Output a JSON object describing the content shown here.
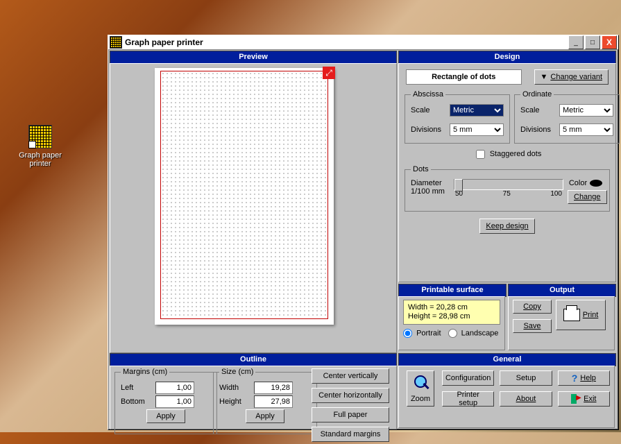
{
  "desktop": {
    "icon_label": "Graph paper printer"
  },
  "window": {
    "title": "Graph paper printer",
    "min": "_",
    "max": "□",
    "close": "X"
  },
  "preview": {
    "title": "Preview"
  },
  "outline": {
    "title": "Outline",
    "margins_legend": "Margins (cm)",
    "left_label": "Left",
    "left_value": "1,00",
    "bottom_label": "Bottom",
    "bottom_value": "1,00",
    "apply": "Apply",
    "size_legend": "Size (cm)",
    "width_label": "Width",
    "width_value": "19,28",
    "height_label": "Height",
    "height_value": "27,98",
    "btn_center_v": "Center vertically",
    "btn_center_h": "Center horizontally",
    "btn_full": "Full paper",
    "btn_std": "Standard margins"
  },
  "design": {
    "title": "Design",
    "variant_name": "Rectangle of dots",
    "change_variant": "Change variant",
    "abscissa": {
      "legend": "Abscissa",
      "scale_label": "Scale",
      "scale_value": "Metric",
      "divisions_label": "Divisions",
      "divisions_value": "5 mm"
    },
    "ordinate": {
      "legend": "Ordinate",
      "scale_label": "Scale",
      "scale_value": "Metric",
      "divisions_label": "Divisions",
      "divisions_value": "5 mm"
    },
    "staggered_label": "Staggered dots",
    "dots": {
      "legend": "Dots",
      "diameter_label": "Diameter",
      "unit_label": "1/100 mm",
      "tick_min": "50",
      "tick_mid": "75",
      "tick_max": "100",
      "color_label": "Color",
      "change": "Change"
    },
    "keep": "Keep design"
  },
  "printable": {
    "title": "Printable surface",
    "width_line": "Width = 20,28 cm",
    "height_line": "Height = 28,98 cm",
    "portrait": "Portrait",
    "landscape": "Landscape"
  },
  "output": {
    "title": "Output",
    "copy": "Copy",
    "save": "Save",
    "print": "Print"
  },
  "general": {
    "title": "General",
    "zoom": "Zoom",
    "configuration": "Configuration",
    "setup": "Setup",
    "help": "Help",
    "printer_setup": "Printer setup",
    "about": "About",
    "exit": "Exit"
  }
}
